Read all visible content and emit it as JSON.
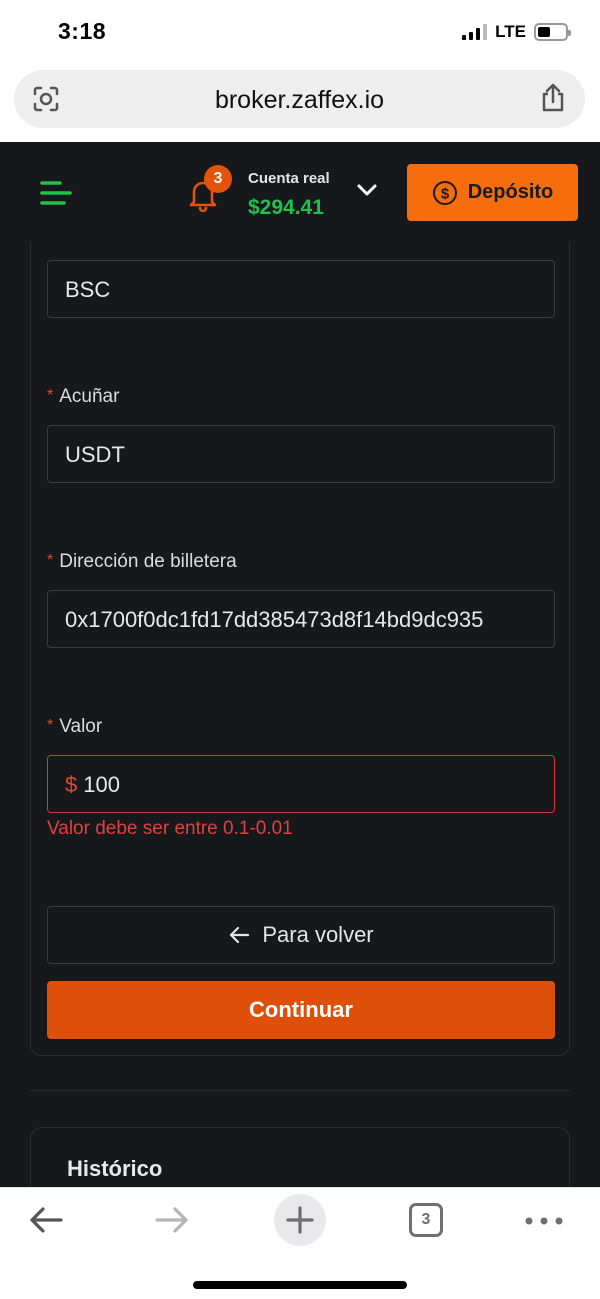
{
  "status_bar": {
    "time": "3:18",
    "network": "LTE"
  },
  "browser": {
    "url": "broker.zaffex.io",
    "tab_count": "3"
  },
  "header": {
    "notification_count": "3",
    "account_label": "Cuenta real",
    "balance": "$294.41",
    "deposit_label": "Depósito"
  },
  "form": {
    "network_value": "BSC",
    "coin_label": "Acuñar",
    "coin_value": "USDT",
    "wallet_label": "Dirección de billetera",
    "wallet_value": "0x1700f0dc1fd17dd385473d8f14bd9dc935",
    "amount_label": "Valor",
    "amount_currency": "$",
    "amount_value": "100",
    "amount_error": "Valor debe ser entre 0.1-0.01",
    "required_mark": "*",
    "back_label": "Para volver",
    "continue_label": "Continuar"
  },
  "history": {
    "title": "Histórico"
  },
  "colors": {
    "background": "#17181c",
    "accent": "#f56d0c",
    "continue": "#de4f0a",
    "balance": "#1fc24b",
    "error": "#e0413c"
  },
  "icons": [
    "lens-icon",
    "share-icon",
    "menu-icon",
    "bell-icon",
    "chevron-down-icon",
    "dollar-circle-icon",
    "arrow-left-icon",
    "back-arrow-icon",
    "forward-arrow-icon",
    "plus-icon",
    "tabs-icon",
    "more-icon"
  ]
}
